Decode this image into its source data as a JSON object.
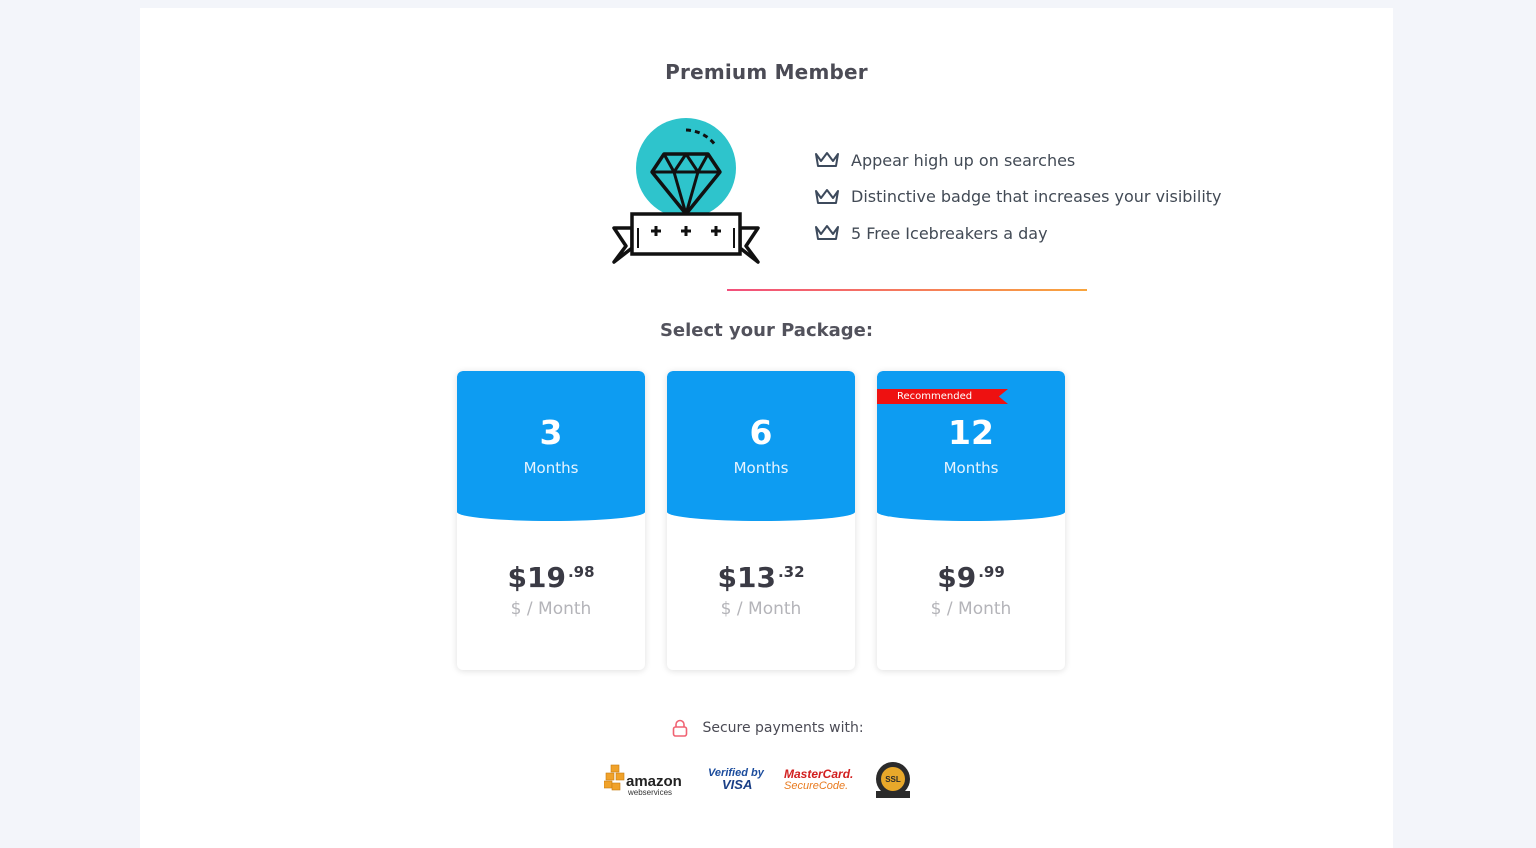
{
  "page": {
    "title": "Premium Member",
    "subtitle": "Select your Package:"
  },
  "features": [
    {
      "icon": "crown-icon",
      "text": "Appear high up on searches"
    },
    {
      "icon": "crown-icon",
      "text": "Distinctive badge that increases your visibility"
    },
    {
      "icon": "crown-icon",
      "text": "5 Free Icebreakers a day"
    }
  ],
  "packages": [
    {
      "number": "3",
      "unit": "Months",
      "price_main": "$19",
      "price_cents": ".98",
      "per": "$ / Month",
      "ribbon": ""
    },
    {
      "number": "6",
      "unit": "Months",
      "price_main": "$13",
      "price_cents": ".32",
      "per": "$ / Month",
      "ribbon": ""
    },
    {
      "number": "12",
      "unit": "Months",
      "price_main": "$9",
      "price_cents": ".99",
      "per": "$ / Month",
      "ribbon": "Recommended"
    }
  ],
  "secure": {
    "icon": "lock-icon",
    "text": "Secure payments with:"
  },
  "payment_logos": {
    "aws_word": "amazon",
    "aws_sub": "webservices",
    "visa_line1": "Verified by",
    "visa_line2": "VISA",
    "mastercard_line1": "MasterCard.",
    "mastercard_line2": "SecureCode.",
    "ssl_badge": "SSL CERTIFIED"
  },
  "colors": {
    "package_blue": "#0d9cf2",
    "ribbon_red": "#ee1111",
    "divider_start": "#f24f7c",
    "divider_end": "#f8a53d",
    "hero_teal": "#2ec4cc"
  }
}
